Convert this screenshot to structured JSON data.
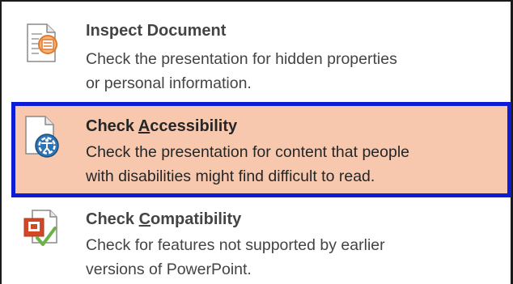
{
  "menu": {
    "items": [
      {
        "id": "inspect",
        "title": "Inspect Document",
        "description_line1": "Check the presentation for hidden properties",
        "description_line2": "or personal information.",
        "icon": "inspect-document-icon"
      },
      {
        "id": "accessibility",
        "title_before": "Check ",
        "title_access_key": "A",
        "title_after": "ccessibility",
        "description_line1": "Check the presentation for content that people",
        "description_line2": "with disabilities might find difficult to read.",
        "icon": "check-accessibility-icon",
        "highlighted": true
      },
      {
        "id": "compatibility",
        "title_before": "Check ",
        "title_access_key": "C",
        "title_after": "ompatibility",
        "description_line1": "Check for features not supported by earlier",
        "description_line2": "versions of PowerPoint.",
        "icon": "check-compatibility-icon"
      }
    ]
  },
  "colors": {
    "highlight_background": "#f7c8ae",
    "highlight_border": "#0d1dd6",
    "text": "#444444"
  }
}
